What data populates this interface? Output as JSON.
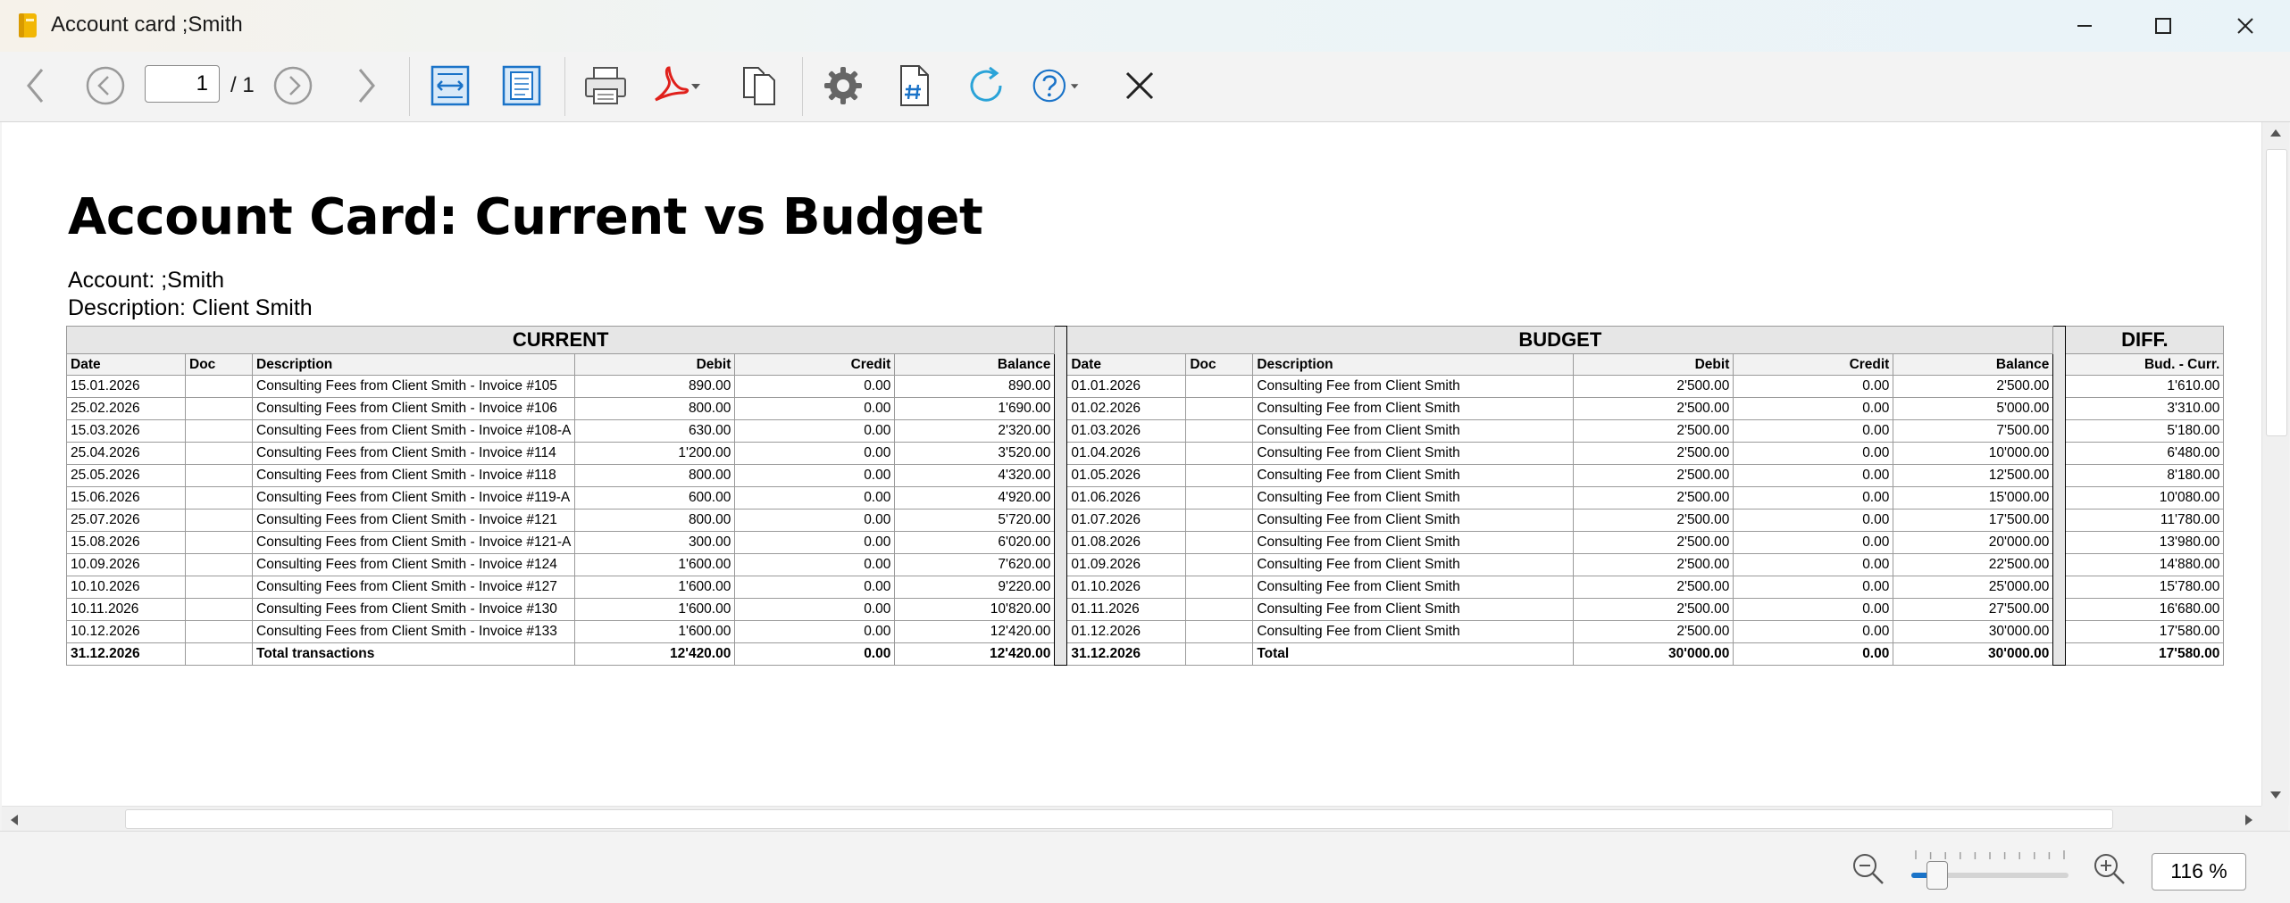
{
  "window": {
    "title": "Account card ;Smith"
  },
  "toolbar": {
    "page_value": "1",
    "page_total": "/ 1"
  },
  "report": {
    "title": "Account Card: Current vs Budget",
    "account": "Account: ;Smith",
    "description": "Description: Client Smith",
    "sections": {
      "current": "CURRENT",
      "budget": "BUDGET",
      "diff": "DIFF."
    },
    "columns": {
      "date": "Date",
      "doc": "Doc",
      "description": "Description",
      "debit": "Debit",
      "credit": "Credit",
      "balance": "Balance",
      "bud_curr": "Bud. - Curr."
    },
    "rows": [
      {
        "cur_date": "15.01.2026",
        "cur_doc": "",
        "cur_desc": "Consulting Fees from Client Smith - Invoice #105",
        "cur_debit": "890.00",
        "cur_credit": "0.00",
        "cur_balance": "890.00",
        "bud_date": "01.01.2026",
        "bud_doc": "",
        "bud_desc": "Consulting Fee from Client Smith",
        "bud_debit": "2'500.00",
        "bud_credit": "0.00",
        "bud_balance": "2'500.00",
        "diff": "1'610.00"
      },
      {
        "cur_date": "25.02.2026",
        "cur_doc": "",
        "cur_desc": "Consulting Fees from Client Smith - Invoice #106",
        "cur_debit": "800.00",
        "cur_credit": "0.00",
        "cur_balance": "1'690.00",
        "bud_date": "01.02.2026",
        "bud_doc": "",
        "bud_desc": "Consulting Fee from Client Smith",
        "bud_debit": "2'500.00",
        "bud_credit": "0.00",
        "bud_balance": "5'000.00",
        "diff": "3'310.00"
      },
      {
        "cur_date": "15.03.2026",
        "cur_doc": "",
        "cur_desc": "Consulting Fees from Client Smith - Invoice #108-A",
        "cur_debit": "630.00",
        "cur_credit": "0.00",
        "cur_balance": "2'320.00",
        "bud_date": "01.03.2026",
        "bud_doc": "",
        "bud_desc": "Consulting Fee from Client Smith",
        "bud_debit": "2'500.00",
        "bud_credit": "0.00",
        "bud_balance": "7'500.00",
        "diff": "5'180.00"
      },
      {
        "cur_date": "25.04.2026",
        "cur_doc": "",
        "cur_desc": "Consulting Fees from Client Smith - Invoice #114",
        "cur_debit": "1'200.00",
        "cur_credit": "0.00",
        "cur_balance": "3'520.00",
        "bud_date": "01.04.2026",
        "bud_doc": "",
        "bud_desc": "Consulting Fee from Client Smith",
        "bud_debit": "2'500.00",
        "bud_credit": "0.00",
        "bud_balance": "10'000.00",
        "diff": "6'480.00"
      },
      {
        "cur_date": "25.05.2026",
        "cur_doc": "",
        "cur_desc": "Consulting Fees from Client Smith - Invoice #118",
        "cur_debit": "800.00",
        "cur_credit": "0.00",
        "cur_balance": "4'320.00",
        "bud_date": "01.05.2026",
        "bud_doc": "",
        "bud_desc": "Consulting Fee from Client Smith",
        "bud_debit": "2'500.00",
        "bud_credit": "0.00",
        "bud_balance": "12'500.00",
        "diff": "8'180.00"
      },
      {
        "cur_date": "15.06.2026",
        "cur_doc": "",
        "cur_desc": "Consulting Fees from Client Smith - Invoice #119-A",
        "cur_debit": "600.00",
        "cur_credit": "0.00",
        "cur_balance": "4'920.00",
        "bud_date": "01.06.2026",
        "bud_doc": "",
        "bud_desc": "Consulting Fee from Client Smith",
        "bud_debit": "2'500.00",
        "bud_credit": "0.00",
        "bud_balance": "15'000.00",
        "diff": "10'080.00"
      },
      {
        "cur_date": "25.07.2026",
        "cur_doc": "",
        "cur_desc": "Consulting Fees from Client Smith - Invoice #121",
        "cur_debit": "800.00",
        "cur_credit": "0.00",
        "cur_balance": "5'720.00",
        "bud_date": "01.07.2026",
        "bud_doc": "",
        "bud_desc": "Consulting Fee from Client Smith",
        "bud_debit": "2'500.00",
        "bud_credit": "0.00",
        "bud_balance": "17'500.00",
        "diff": "11'780.00"
      },
      {
        "cur_date": "15.08.2026",
        "cur_doc": "",
        "cur_desc": "Consulting Fees from Client Smith - Invoice #121-A",
        "cur_debit": "300.00",
        "cur_credit": "0.00",
        "cur_balance": "6'020.00",
        "bud_date": "01.08.2026",
        "bud_doc": "",
        "bud_desc": "Consulting Fee from Client Smith",
        "bud_debit": "2'500.00",
        "bud_credit": "0.00",
        "bud_balance": "20'000.00",
        "diff": "13'980.00"
      },
      {
        "cur_date": "10.09.2026",
        "cur_doc": "",
        "cur_desc": "Consulting Fees from Client Smith - Invoice #124",
        "cur_debit": "1'600.00",
        "cur_credit": "0.00",
        "cur_balance": "7'620.00",
        "bud_date": "01.09.2026",
        "bud_doc": "",
        "bud_desc": "Consulting Fee from Client Smith",
        "bud_debit": "2'500.00",
        "bud_credit": "0.00",
        "bud_balance": "22'500.00",
        "diff": "14'880.00"
      },
      {
        "cur_date": "10.10.2026",
        "cur_doc": "",
        "cur_desc": "Consulting Fees from Client Smith - Invoice #127",
        "cur_debit": "1'600.00",
        "cur_credit": "0.00",
        "cur_balance": "9'220.00",
        "bud_date": "01.10.2026",
        "bud_doc": "",
        "bud_desc": "Consulting Fee from Client Smith",
        "bud_debit": "2'500.00",
        "bud_credit": "0.00",
        "bud_balance": "25'000.00",
        "diff": "15'780.00"
      },
      {
        "cur_date": "10.11.2026",
        "cur_doc": "",
        "cur_desc": "Consulting Fees from Client Smith - Invoice #130",
        "cur_debit": "1'600.00",
        "cur_credit": "0.00",
        "cur_balance": "10'820.00",
        "bud_date": "01.11.2026",
        "bud_doc": "",
        "bud_desc": "Consulting Fee from Client Smith",
        "bud_debit": "2'500.00",
        "bud_credit": "0.00",
        "bud_balance": "27'500.00",
        "diff": "16'680.00"
      },
      {
        "cur_date": "10.12.2026",
        "cur_doc": "",
        "cur_desc": "Consulting Fees from Client Smith - Invoice #133",
        "cur_debit": "1'600.00",
        "cur_credit": "0.00",
        "cur_balance": "12'420.00",
        "bud_date": "01.12.2026",
        "bud_doc": "",
        "bud_desc": "Consulting Fee from Client Smith",
        "bud_debit": "2'500.00",
        "bud_credit": "0.00",
        "bud_balance": "30'000.00",
        "diff": "17'580.00"
      }
    ],
    "total": {
      "cur_date": "31.12.2026",
      "cur_doc": "",
      "cur_desc": "Total transactions",
      "cur_debit": "12'420.00",
      "cur_credit": "0.00",
      "cur_balance": "12'420.00",
      "bud_date": "31.12.2026",
      "bud_doc": "",
      "bud_desc": "Total",
      "bud_debit": "30'000.00",
      "bud_credit": "0.00",
      "bud_balance": "30'000.00",
      "diff": "17'580.00"
    }
  },
  "zoom": {
    "value": "116 %",
    "level": 0.16
  },
  "icons": {
    "app": "ledger-book-icon",
    "minimize": "minimize-icon",
    "maximize": "maximize-icon",
    "close": "close-icon",
    "nav_first": "chevron-left-icon",
    "nav_prev": "circle-chevron-left-icon",
    "nav_next": "circle-chevron-right-icon",
    "nav_last": "chevron-right-icon",
    "fit_width": "fit-width-icon",
    "fit_page": "fit-page-icon",
    "print": "printer-icon",
    "pdf": "pdf-icon",
    "copy": "copy-icon",
    "settings": "gear-icon",
    "page_number": "page-number-icon",
    "refresh": "refresh-icon",
    "help": "help-icon",
    "close_report": "close-icon",
    "zoom_out": "zoom-out-icon",
    "zoom_in": "zoom-in-icon"
  },
  "colors": {
    "accent": "#1a73c8",
    "app_icon": "#f2b705",
    "pdf": "#e0201b",
    "separator": "#000000"
  }
}
